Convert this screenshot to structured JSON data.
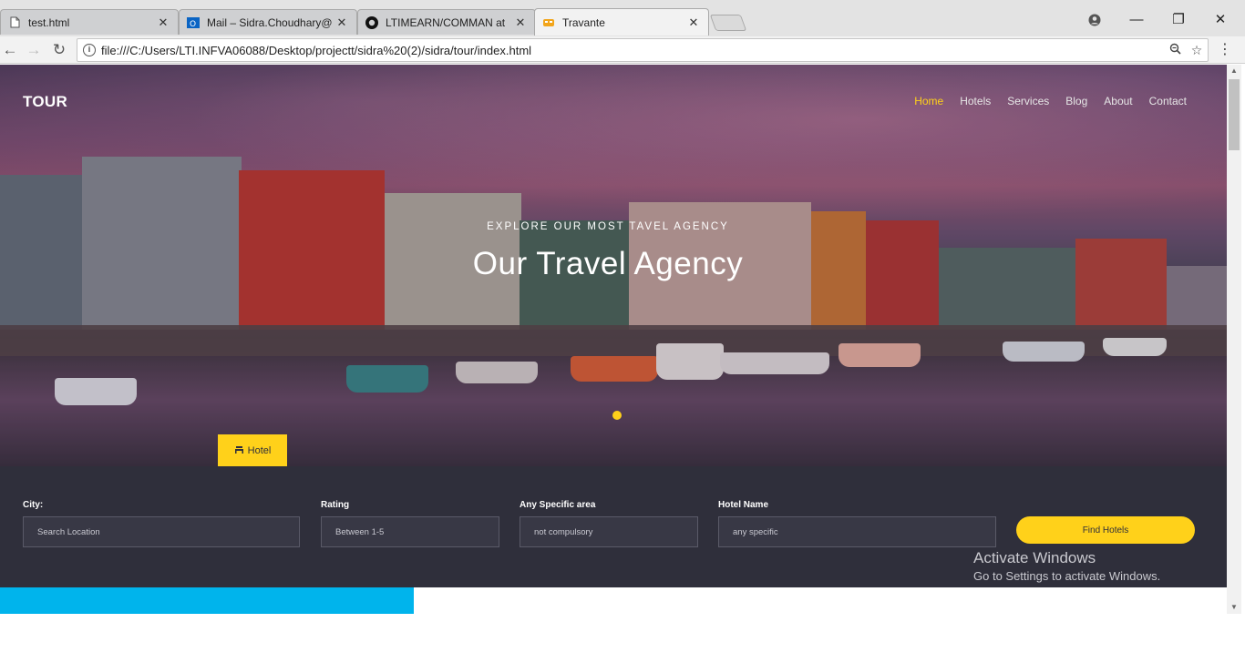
{
  "browser": {
    "tabs": [
      {
        "title": "test.html",
        "icon": "page-icon",
        "active": false
      },
      {
        "title": "Mail – Sidra.Choudhary@",
        "icon": "outlook-icon",
        "active": false
      },
      {
        "title": "LTIMEARN/COMMAN at",
        "icon": "github-icon",
        "active": false
      },
      {
        "title": "Travante",
        "icon": "travel-icon",
        "active": true
      }
    ],
    "url": "file:///C:/Users/LTI.INFVA06088/Desktop/projectt/sidra%20(2)/sidra/tour/index.html"
  },
  "site": {
    "logo": "TOUR",
    "nav": [
      "Home",
      "Hotels",
      "Services",
      "Blog",
      "About",
      "Contact"
    ],
    "hero_subtitle": "EXPLORE OUR MOST TAVEL AGENCY",
    "hero_title": "Our Travel Agency",
    "hotel_tab": "Hotel"
  },
  "search": {
    "city_label": "City:",
    "city_placeholder": "Search Location",
    "rating_label": "Rating",
    "rating_placeholder": "Between 1-5",
    "area_label": "Any Specific area",
    "area_placeholder": "not compulsory",
    "hotel_label": "Hotel Name",
    "hotel_placeholder": "any specific",
    "button": "Find Hotels"
  },
  "watermark": {
    "line1": "Activate Windows",
    "line2": "Go to Settings to activate Windows."
  },
  "colors": {
    "accent": "#ffd11a",
    "search_bg": "#2f2f3b",
    "cyan": "#00b4ec"
  }
}
